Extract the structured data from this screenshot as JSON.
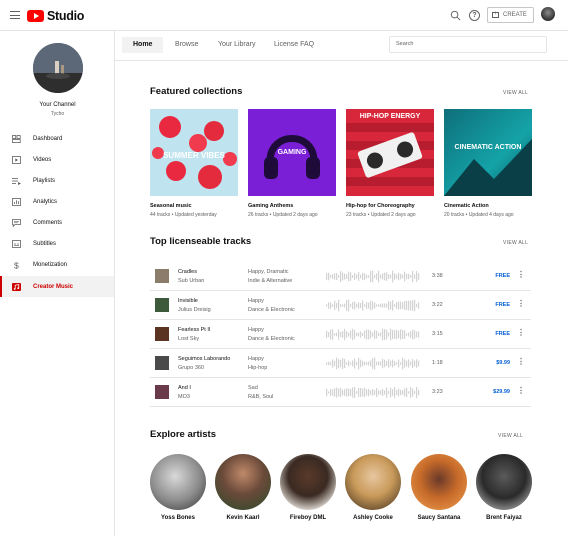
{
  "header": {
    "brand": "Studio",
    "create_label": "CREATE",
    "help_glyph": "?",
    "icons": [
      "menu-icon",
      "search-icon",
      "help-icon",
      "create-video-icon"
    ]
  },
  "sidebar": {
    "channel_name": "Your Channel",
    "channel_handle": "Tycho",
    "items": [
      {
        "label": "Dashboard",
        "icon": "dashboard-icon"
      },
      {
        "label": "Videos",
        "icon": "videos-icon"
      },
      {
        "label": "Playlists",
        "icon": "playlists-icon"
      },
      {
        "label": "Analytics",
        "icon": "analytics-icon"
      },
      {
        "label": "Comments",
        "icon": "comments-icon"
      },
      {
        "label": "Subtitles",
        "icon": "subtitles-icon"
      },
      {
        "label": "Monetization",
        "icon": "dollar-icon"
      },
      {
        "label": "Creator Music",
        "icon": "creator-music-icon",
        "active": true
      }
    ]
  },
  "tabs": [
    {
      "label": "Home",
      "active": true
    },
    {
      "label": "Browse"
    },
    {
      "label": "Your Library"
    },
    {
      "label": "License FAQ"
    }
  ],
  "search": {
    "placeholder": "Search"
  },
  "featured": {
    "title": "Featured collections",
    "view_all": "VIEW ALL",
    "cards": [
      {
        "cover_text": "SUMMER VIBES",
        "title": "Seasonal music",
        "meta": "44 tracks • Updated yesterday"
      },
      {
        "cover_text": "GAMING",
        "title": "Gaming Anthems",
        "meta": "26 tracks • Updated 2 days ago"
      },
      {
        "cover_text": "HIP-HOP ENERGY",
        "title": "Hip-hop for Choreography",
        "meta": "23 tracks • Updated 2 days ago"
      },
      {
        "cover_text": "CINEMATIC ACTION",
        "title": "Cinematic Action",
        "meta": "20 tracks • Updated 4 days ago"
      }
    ]
  },
  "tracks": {
    "title": "Top licenseable tracks",
    "view_all": "VIEW ALL",
    "more_glyph": "⋮",
    "rows": [
      {
        "name": "Cradles",
        "artist": "Sub Urban",
        "mood": "Happy, Dramatic",
        "genre": "Indie & Alternative",
        "duration": "3:38",
        "price": "FREE"
      },
      {
        "name": "Invisible",
        "artist": "Julius Dreisig",
        "mood": "Happy",
        "genre": "Dance & Electronic",
        "duration": "3:22",
        "price": "FREE"
      },
      {
        "name": "Fearless Pt II",
        "artist": "Lost Sky",
        "mood": "Happy",
        "genre": "Dance & Electronic",
        "duration": "3:15",
        "price": "FREE"
      },
      {
        "name": "Seguimos Laborando",
        "artist": "Grupo 360",
        "mood": "Happy",
        "genre": "Hip-hop",
        "duration": "1:18",
        "price": "$9.99"
      },
      {
        "name": "And I",
        "artist": "MO3",
        "mood": "Sad",
        "genre": "R&B, Soul",
        "duration": "3:23",
        "price": "$29.99"
      }
    ]
  },
  "artists": {
    "title": "Explore artists",
    "view_all": "VIEW ALL",
    "items": [
      {
        "name": "Yoss Bones"
      },
      {
        "name": "Kevin Kaarl"
      },
      {
        "name": "Fireboy DML"
      },
      {
        "name": "Ashley Cooke"
      },
      {
        "name": "Saucy Santana"
      },
      {
        "name": "Brent Faiyaz"
      }
    ]
  },
  "colors": {
    "accent": "#cc0000",
    "link": "#065fd4",
    "brand_red": "#ff0000"
  }
}
